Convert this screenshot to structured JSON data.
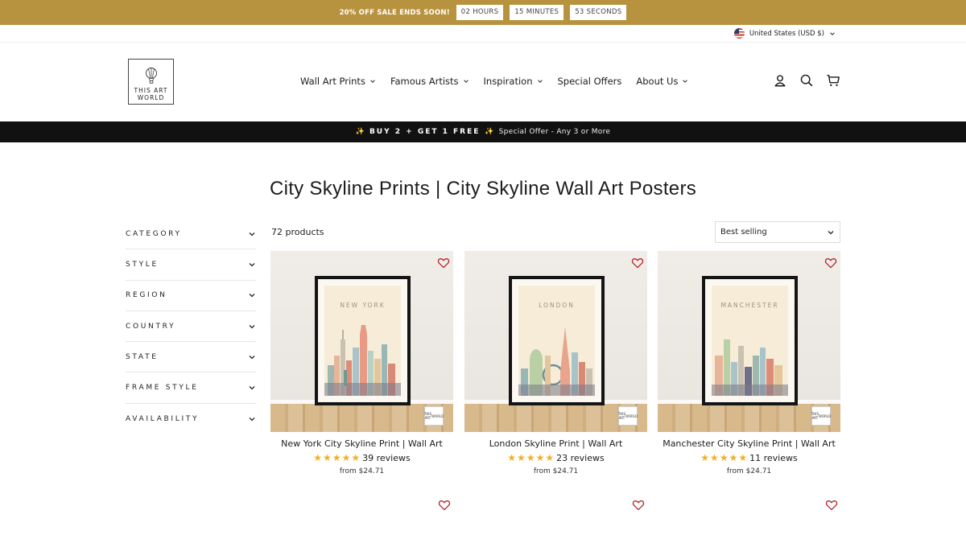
{
  "promo": {
    "text": "20% OFF SALE ENDS SOON!",
    "hours": "02 HOURS",
    "minutes": "15 MINUTES",
    "seconds": "53 SECONDS",
    "bg_color": "#b8933f"
  },
  "locale": {
    "label": "United States (USD $)"
  },
  "logo": {
    "line1": "THIS ART",
    "line2": "WORLD"
  },
  "nav": [
    {
      "label": "Wall Art Prints",
      "has_dropdown": true
    },
    {
      "label": "Famous Artists",
      "has_dropdown": true
    },
    {
      "label": "Inspiration",
      "has_dropdown": true
    },
    {
      "label": "Special Offers",
      "has_dropdown": false
    },
    {
      "label": "About Us",
      "has_dropdown": true
    }
  ],
  "header_icons": [
    "account-icon",
    "search-icon",
    "cart-icon"
  ],
  "offer_bar": {
    "highlight": "BUY 2 + GET 1 FREE",
    "sub": "Special Offer - Any 3 or More",
    "sparkle": "✨"
  },
  "page": {
    "title": "City Skyline Prints | City Skyline Wall Art Posters"
  },
  "filters": [
    "CATEGORY",
    "STYLE",
    "REGION",
    "COUNTRY",
    "STATE",
    "FRAME STYLE",
    "AVAILABILITY"
  ],
  "results": {
    "count": "72 products",
    "sort_selected": "Best selling"
  },
  "products": [
    {
      "name": "New York City Skyline Print | Wall Art",
      "city": "NEW YORK",
      "stars": "★★★★★",
      "reviews": "39 reviews",
      "price": "from $24.71",
      "rating": 5
    },
    {
      "name": "London Skyline Print | Wall Art",
      "city": "LONDON",
      "stars": "★★★★★",
      "reviews": "23 reviews",
      "price": "from $24.71",
      "rating": 5
    },
    {
      "name": "Manchester City Skyline Print | Wall Art",
      "city": "MANCHESTER",
      "stars": "★★★★★",
      "reviews": "11 reviews",
      "price": "from $24.71",
      "rating": 5
    }
  ],
  "badge": {
    "line1": "THIS ART",
    "line2": "WORLD"
  },
  "colors": {
    "accent_gold": "#b8933f",
    "star": "#f2b01e",
    "heart": "#b3262e",
    "dark_bar": "#111111"
  }
}
